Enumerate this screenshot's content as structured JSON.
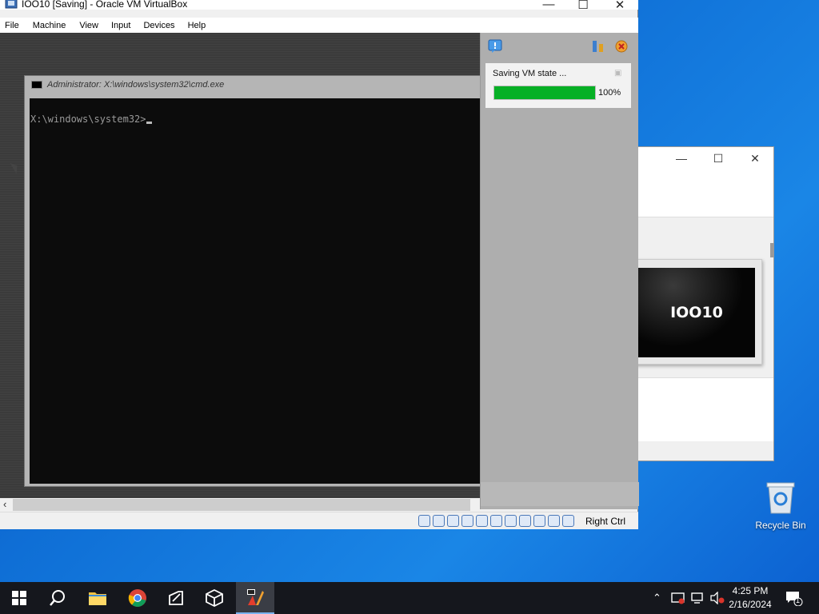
{
  "desktop": {
    "recycle_bin_label": "Recycle Bin"
  },
  "vm_window": {
    "title": "IOO10 [Saving] - Oracle VM VirtualBox",
    "menu": [
      "File",
      "Machine",
      "View",
      "Input",
      "Devices",
      "Help"
    ],
    "cmd_title": "Administrator: X:\\windows\\system32\\cmd.exe",
    "cmd_prompt": "X:\\windows\\system32>",
    "notification": {
      "text": "Saving VM state ...",
      "progress_percent": 100,
      "progress_label": "100%",
      "progress_color": "#06b025"
    },
    "host_key": "Right Ctrl"
  },
  "manager_window": {
    "vm_preview_name": "IOO10"
  },
  "taskbar": {
    "time": "4:25 PM",
    "date": "2/16/2024",
    "notification_count": "1"
  }
}
